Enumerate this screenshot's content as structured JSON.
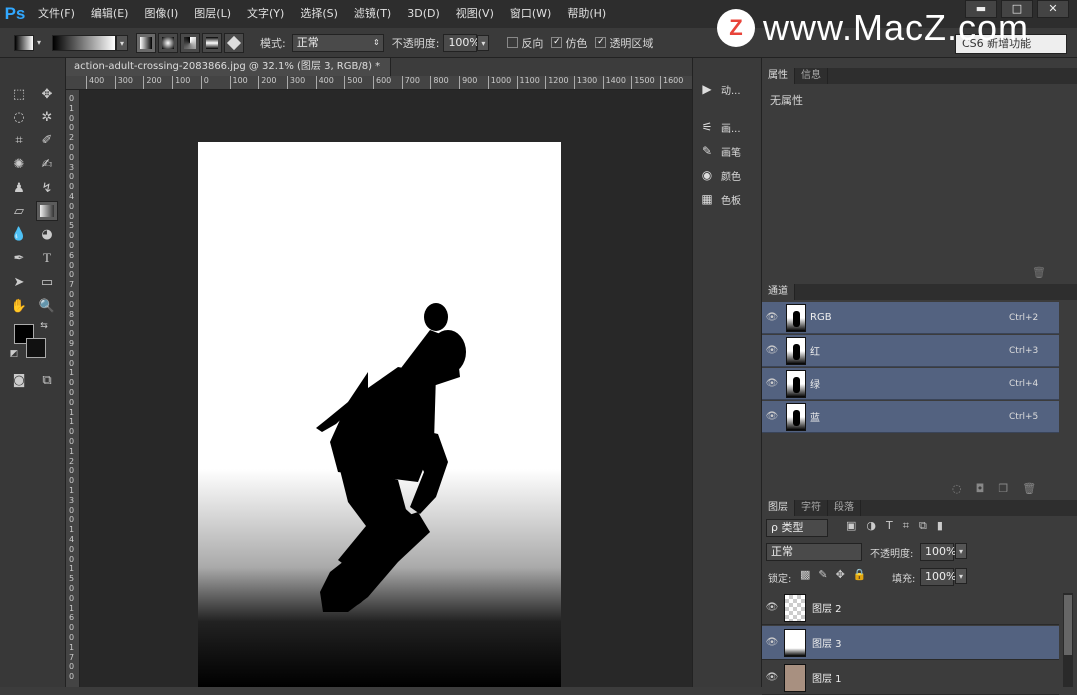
{
  "app": {
    "logo": "Ps"
  },
  "menu": [
    "文件(F)",
    "编辑(E)",
    "图像(I)",
    "图层(L)",
    "文字(Y)",
    "选择(S)",
    "滤镜(T)",
    "3D(D)",
    "视图(V)",
    "窗口(W)",
    "帮助(H)"
  ],
  "window_controls": {
    "minimize": "▬",
    "maximize": "□",
    "close": "✕"
  },
  "watermark": {
    "logo_letter": "Z",
    "text": "www.MacZ.com"
  },
  "options": {
    "mode_label": "模式:",
    "mode_value": "正常",
    "opacity_label": "不透明度:",
    "opacity_value": "100%",
    "reverse": "反向",
    "dither": "仿色",
    "transparency": "透明区域",
    "workspace": "CS6 新增功能"
  },
  "document": {
    "tab_title": "action-adult-crossing-2083866.jpg @ 32.1% (图层 3, RGB/8) *",
    "close": "×"
  },
  "ruler_h": [
    "400",
    "300",
    "200",
    "100",
    "0",
    "100",
    "200",
    "300",
    "400",
    "500",
    "600",
    "700",
    "800",
    "900",
    "1000",
    "1100",
    "1200",
    "1300",
    "1400",
    "1500",
    "1600"
  ],
  "ruler_v": [
    "0",
    "1",
    "0",
    "0",
    "2",
    "0",
    "0",
    "3",
    "0",
    "0",
    "4",
    "0",
    "0",
    "5",
    "0",
    "0",
    "6",
    "0",
    "0",
    "7",
    "0",
    "0",
    "8",
    "0",
    "0",
    "9",
    "0",
    "0",
    "1",
    "0",
    "0",
    "0",
    "1",
    "1",
    "0",
    "0",
    "1",
    "2",
    "0",
    "0",
    "1",
    "3",
    "0",
    "0",
    "1",
    "4",
    "0",
    "0",
    "1",
    "5",
    "0",
    "0",
    "1",
    "6",
    "0",
    "0",
    "1",
    "7",
    "0",
    "0"
  ],
  "midpanel": [
    {
      "icon": "▶",
      "label": "动..."
    },
    {
      "icon": "⚟",
      "label": "画..."
    },
    {
      "icon": "✎",
      "label": "画笔"
    },
    {
      "icon": "◉",
      "label": "颜色"
    },
    {
      "icon": "▦",
      "label": "色板"
    }
  ],
  "properties": {
    "tabs": [
      "属性",
      "信息"
    ],
    "content": "无属性"
  },
  "channels": {
    "tab": "通道",
    "rows": [
      {
        "name": "RGB",
        "key": "Ctrl+2"
      },
      {
        "name": "红",
        "key": "Ctrl+3"
      },
      {
        "name": "绿",
        "key": "Ctrl+4"
      },
      {
        "name": "蓝",
        "key": "Ctrl+5"
      }
    ]
  },
  "layers": {
    "tabs": [
      "图层",
      "字符",
      "段落"
    ],
    "filter": "ρ 类型",
    "blend": "正常",
    "opacity_label": "不透明度:",
    "opacity": "100%",
    "lock_label": "锁定:",
    "fill_label": "填充:",
    "fill": "100%",
    "rows": [
      {
        "name": "图层 2"
      },
      {
        "name": "图层 3"
      },
      {
        "name": "图层 1"
      }
    ]
  }
}
